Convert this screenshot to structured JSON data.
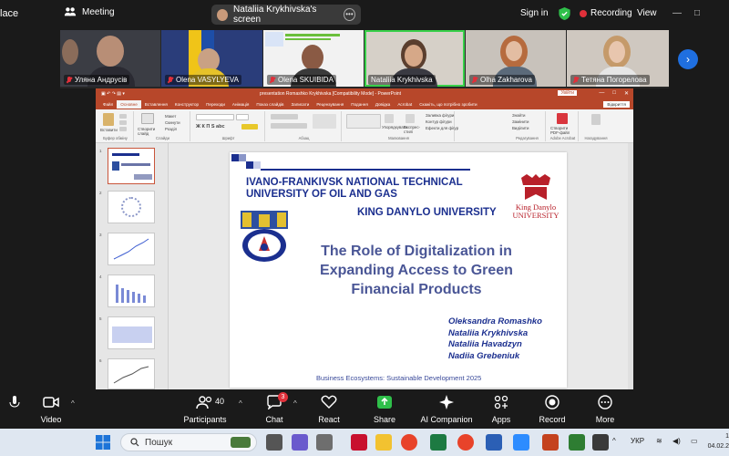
{
  "topbar": {
    "left_text": "lace",
    "meeting_label": "Meeting",
    "screen_share_label": "Nataliia Krykhivska's screen",
    "signin_label": "Sign in",
    "recording_label": "Recording",
    "view_label": "View"
  },
  "gallery": {
    "participants": [
      {
        "name": "Уляна Андрусів",
        "muted": true
      },
      {
        "name": "Olena VASYLYEVA",
        "muted": true
      },
      {
        "name": "Olena SKUIBIDA",
        "muted": true
      },
      {
        "name": "Nataliia Krykhivska",
        "muted": false,
        "active": true
      },
      {
        "name": "Olha Zakharova",
        "muted": true
      },
      {
        "name": "Тетяна Погорелова",
        "muted": true
      }
    ]
  },
  "ppt": {
    "window_title": "presentation Romashko Krykhivska [Compatibility Mode] - PowerPoint",
    "signin_label": "Увійти",
    "tabs": [
      "Файл",
      "Основне",
      "Вставлення",
      "Конструктор",
      "Переходи",
      "Анімація",
      "Показ слайдів",
      "Записати",
      "Рецензування",
      "Подання",
      "Довідка",
      "Acrobat",
      "Скажіть, що потрібно зробити"
    ],
    "share_label": "Відкриття",
    "ribbon_groups": [
      "Буфер обміну",
      "Слайди",
      "Шрифт",
      "Абзац",
      "Малювання",
      "Редагування",
      "Adobe Acrobat",
      "Нагадування"
    ],
    "ribbon_labels": {
      "paste": "Вставити",
      "new_slide": "Створити слайд",
      "layout": "Макет",
      "reset": "Скинути",
      "section": "Розділ",
      "arrange": "Упорядкувати",
      "quick_styles": "Експрес-стилі",
      "shape_fill": "Заливка фігури",
      "shape_outline": "Контур фігури",
      "shape_effects": "Ефекти для фігур",
      "find": "Знайти",
      "replace": "Замінити",
      "select": "Виділити",
      "create_pdf": "Створити PDF-файл"
    },
    "thumbnail_numbers": [
      "1",
      "2",
      "3",
      "4",
      "5",
      "6"
    ]
  },
  "slide": {
    "university_line1": "IVANO-FRANKIVSK NATIONAL TECHNICAL",
    "university_line2": "UNIVERSITY OF OIL AND GAS",
    "university_second": "KING DANYLO UNIVERSITY",
    "kdu_logo_line1": "King Danylo",
    "kdu_logo_line2": "UNIVERSITY",
    "title_line1": "The Role of Digitalization in",
    "title_line2": "Expanding Access to Green",
    "title_line3": "Financial Products",
    "authors": [
      "Oleksandra Romashko",
      "Nataliia Krykhivska",
      "Nataliia Havadzyn",
      "Nadiia Grebeniuk"
    ],
    "footer": "Business Ecosystems: Sustainable Development 2025"
  },
  "toolbar": {
    "audio_label": "",
    "video_label": "Video",
    "participants_label": "Participants",
    "participants_count": "40",
    "chat_label": "Chat",
    "chat_badge": "3",
    "react_label": "React",
    "share_label": "Share",
    "ai_label": "AI Companion",
    "apps_label": "Apps",
    "record_label": "Record",
    "more_label": "More"
  },
  "taskbar": {
    "search_placeholder": "Пошук",
    "language": "УКР",
    "date": "04.02.2",
    "time_top": "1"
  },
  "colors": {
    "accent_green": "#38d04a",
    "recording_red": "#e0303a",
    "ppt_brand": "#b7472a",
    "slide_navy": "#1b2f8f"
  }
}
